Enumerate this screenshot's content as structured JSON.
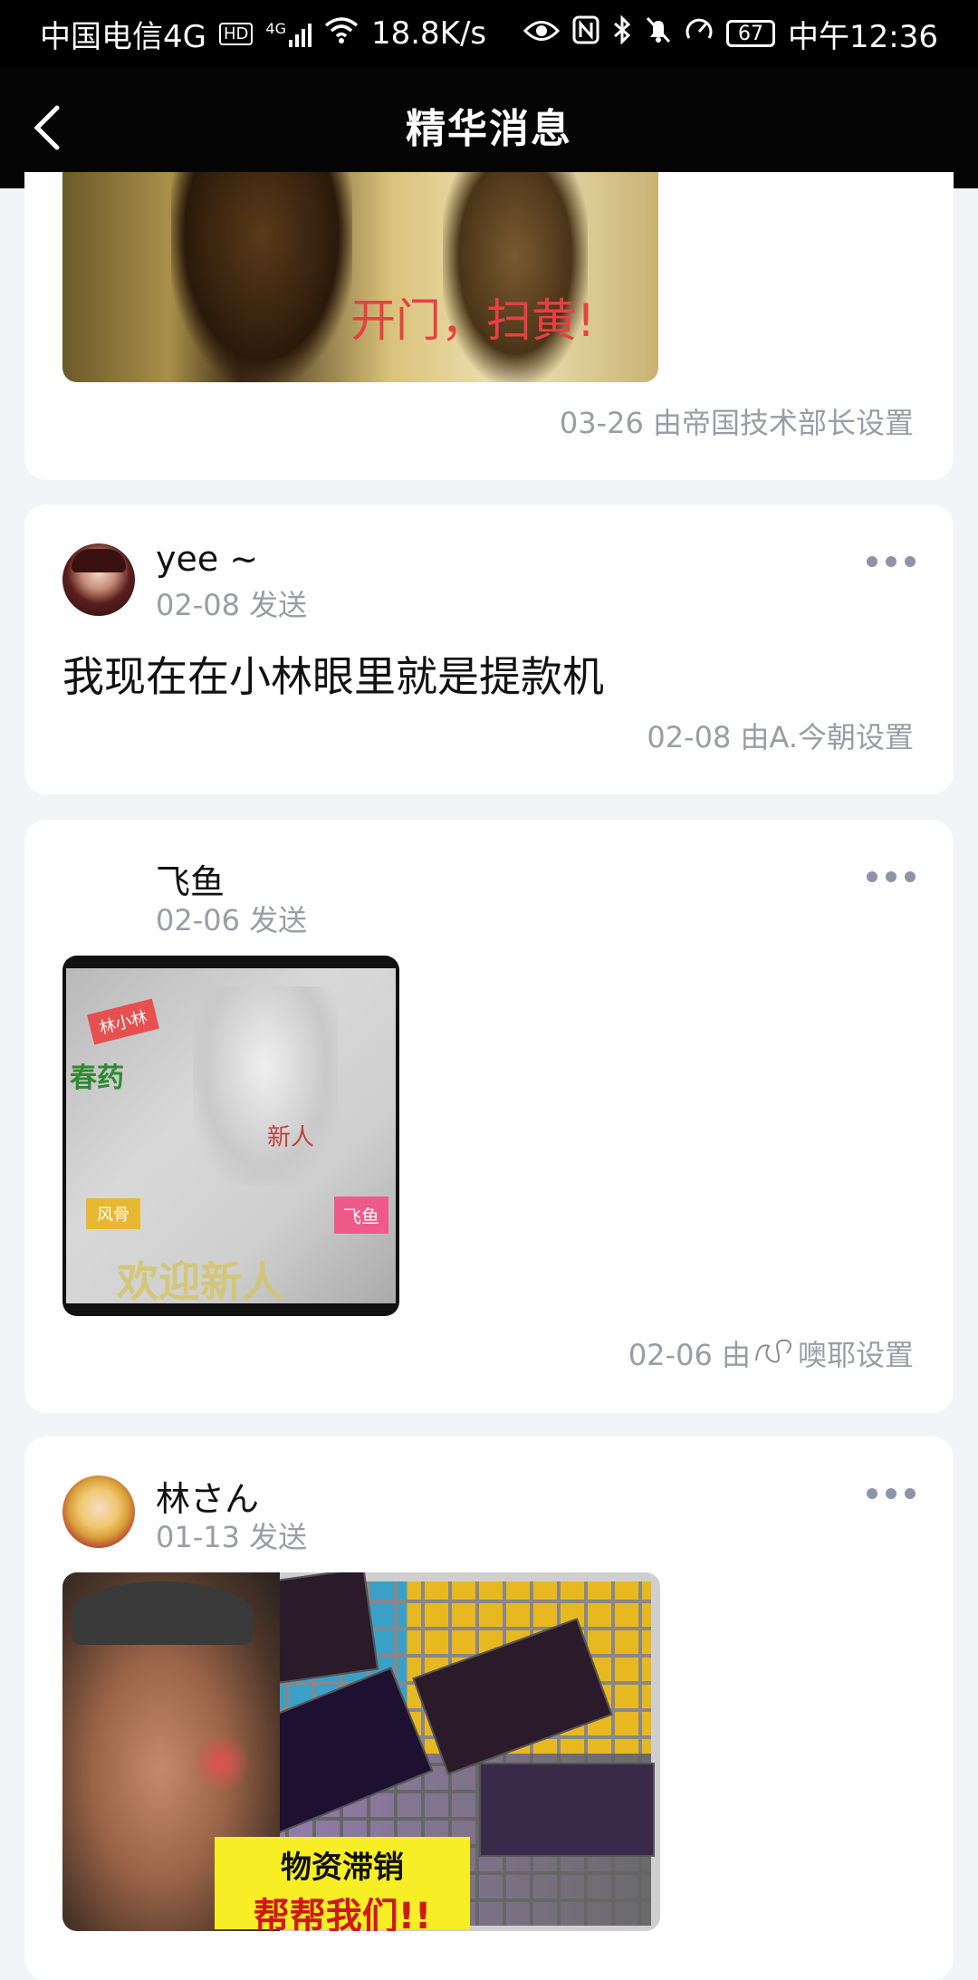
{
  "status_bar": {
    "carrier": "中国电信4G",
    "hd": "HD",
    "net_type": "4G",
    "speed": "18.8K/s",
    "battery": "67",
    "time": "中午12:36"
  },
  "header": {
    "title": "精华消息",
    "back_icon": "chevron-left-icon"
  },
  "cards": [
    {
      "image_caption": "开门，扫黄!",
      "footer": "03-26 由帝国技术部长设置"
    },
    {
      "user": "yee ~",
      "sent": "02-08 发送",
      "text": "我现在在小林眼里就是提款机",
      "footer": "02-08 由A.今朝设置"
    },
    {
      "user": "飞鱼",
      "sent": "02-06 发送",
      "image_labels": [
        "林小林",
        "春药",
        "新人",
        "风骨",
        "飞鱼",
        "欢迎新人"
      ],
      "footer": "02-06 由",
      "footer_suffix": "噢耶设置"
    },
    {
      "user": "林さん",
      "sent": "01-13 发送",
      "image_labels": [
        "物资滞销",
        "帮帮我们!!"
      ]
    }
  ]
}
